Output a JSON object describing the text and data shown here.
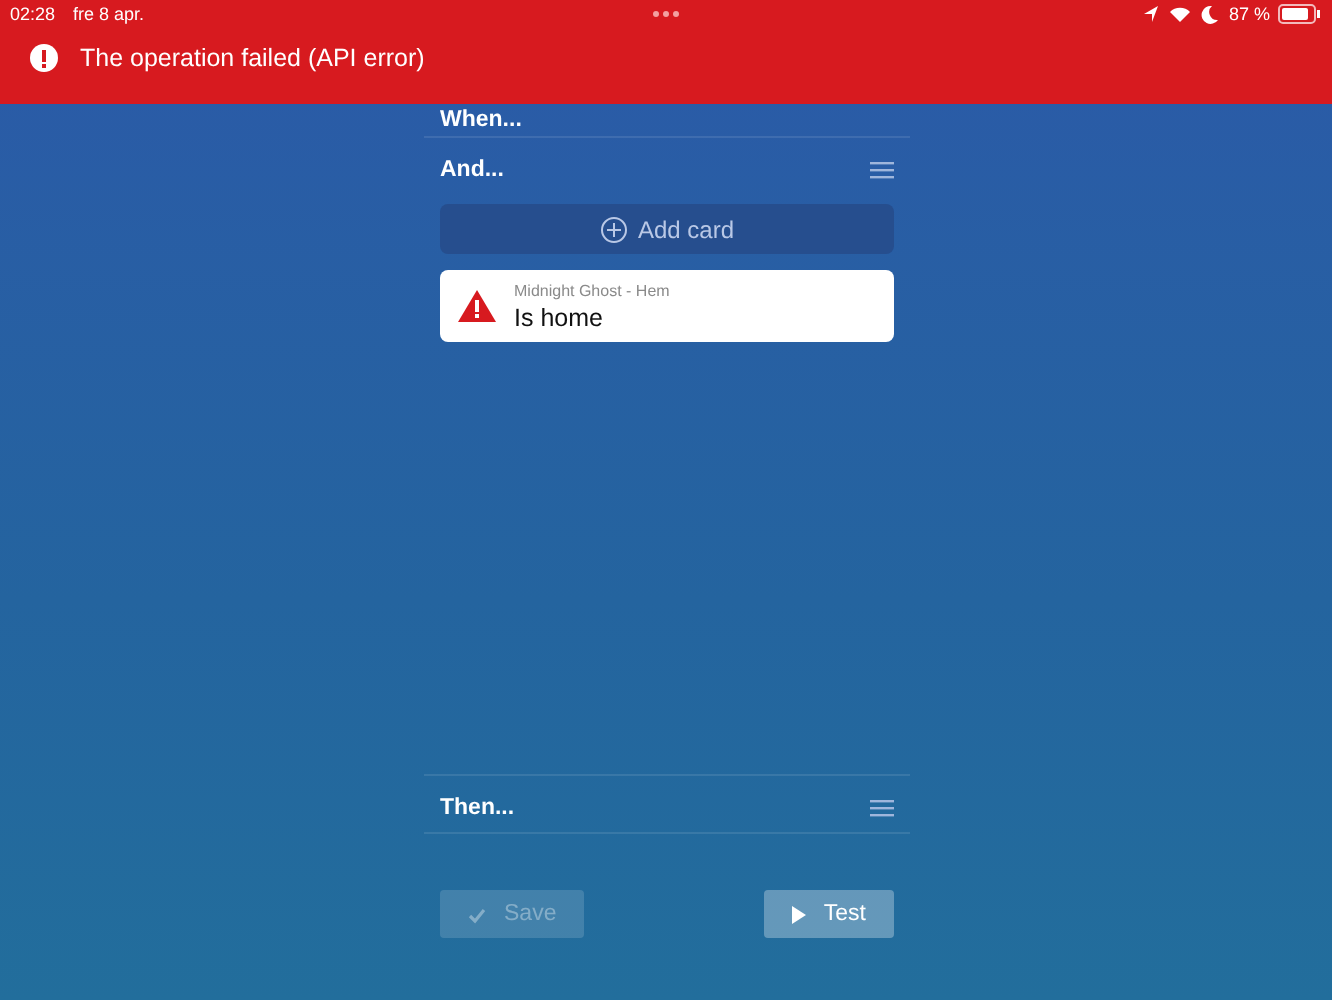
{
  "status_bar": {
    "time": "02:28",
    "date": "fre 8 apr.",
    "battery": "87 %"
  },
  "banner": {
    "message": "The operation failed (API error)"
  },
  "sections": [
    {
      "title": "When...",
      "has_menu": false
    },
    {
      "title": "And...",
      "has_menu": true,
      "add_card": "Add card",
      "cards": [
        {
          "subtitle": "Midnight Ghost - Hem",
          "title": "Is home",
          "kind": "warning"
        }
      ]
    },
    {
      "title": "Then...",
      "has_menu": true
    }
  ],
  "buttons": [
    {
      "label": "Save",
      "kind": "save",
      "disabled": true
    },
    {
      "label": "Test",
      "kind": "test",
      "disabled": false
    }
  ]
}
